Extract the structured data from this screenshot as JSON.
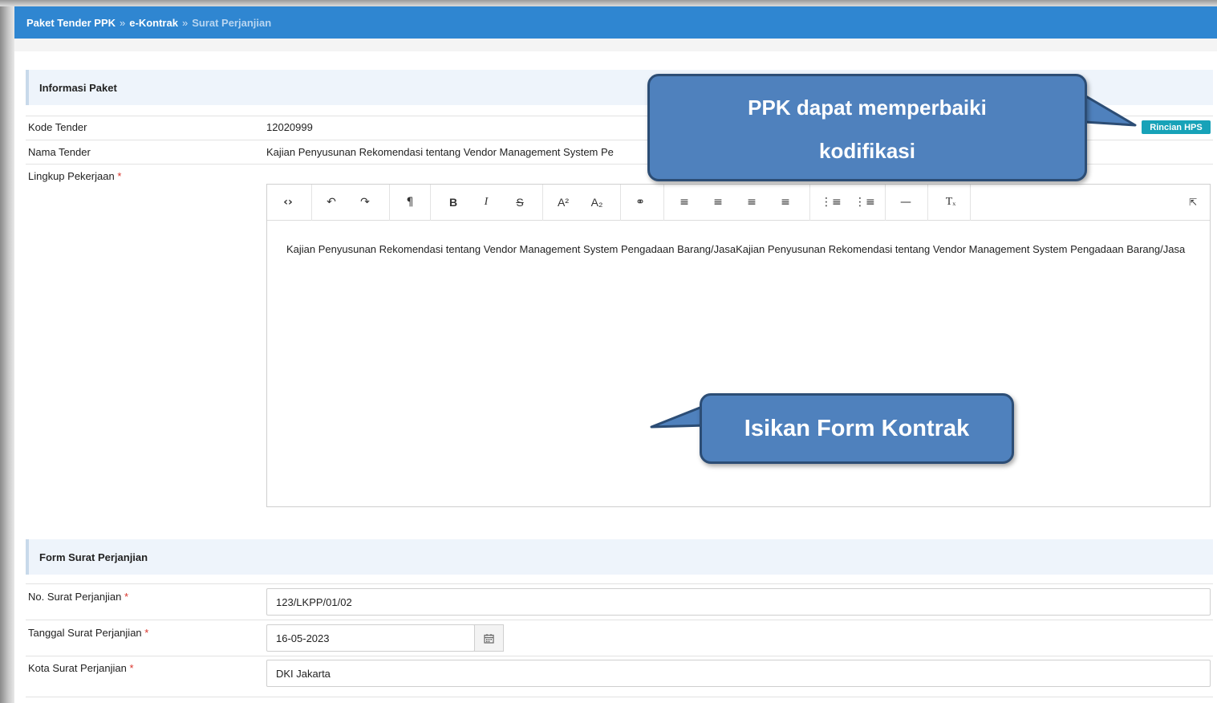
{
  "breadcrumb": {
    "items": [
      "Paket Tender PPK",
      "e-Kontrak"
    ],
    "current": "Surat Perjanjian",
    "separator": "»"
  },
  "informasi_paket": {
    "title": "Informasi Paket",
    "kode_tender_label": "Kode Tender",
    "kode_tender_value": "12020999",
    "nama_tender_label": "Nama Tender",
    "nama_tender_value": "Kajian Penyusunan Rekomendasi tentang Vendor Management System Pe",
    "lingkup_label": "Lingkup Pekerjaan",
    "required_mark": "*",
    "rincian_hps_button": "Rincian HPS"
  },
  "editor": {
    "toolbar_icons": [
      "html-code-icon",
      "undo-icon",
      "redo-icon",
      "paragraph-format-icon",
      "bold-icon",
      "italic-icon",
      "strikethrough-icon",
      "superscript-icon",
      "subscript-icon",
      "link-icon",
      "align-left-icon",
      "align-center-icon",
      "align-right-icon",
      "align-justify-icon",
      "unordered-list-icon",
      "ordered-list-icon",
      "horizontal-rule-icon",
      "clear-format-icon",
      "fullscreen-icon"
    ],
    "content": "Kajian Penyusunan Rekomendasi tentang Vendor Management System Pengadaan Barang/JasaKajian Penyusunan Rekomendasi tentang Vendor Management System Pengadaan Barang/Jasa"
  },
  "form_surat": {
    "title": "Form Surat Perjanjian",
    "no_label": "No. Surat Perjanjian",
    "no_value": "123/LKPP/01/02",
    "tanggal_label": "Tanggal Surat Perjanjian",
    "tanggal_value": "16-05-2023",
    "kota_label": "Kota Surat Perjanjian",
    "kota_value": "DKI Jakarta"
  },
  "callouts": {
    "top_line1": "PPK dapat memperbaiki",
    "top_line2": "kodifikasi",
    "bottom": "Isikan Form Kontrak"
  },
  "colors": {
    "topbar": "#2f86d1",
    "callout_fill": "#4f81bd",
    "callout_border": "#2c4d75",
    "hps_button": "#17a2b8"
  }
}
